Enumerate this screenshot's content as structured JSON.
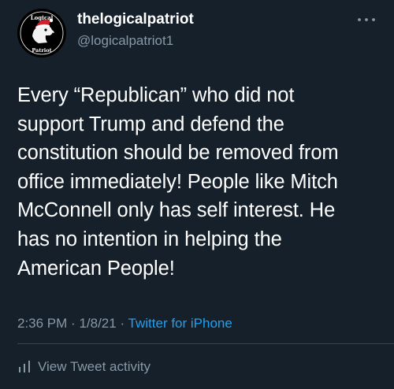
{
  "tweet": {
    "author": {
      "display_name": "thelogicalpatriot",
      "handle": "@logicalpatriot1",
      "avatar_text_top": "Logical",
      "avatar_text_bottom": "Patriot",
      "avatar_icon": "eagle-head-icon"
    },
    "text": "Every “Republican” who did not\nsupport Trump and defend the\nconstitution should be removed from\noffice immediately! People like Mitch\nMcConnell only has self interest. He\nhas no intention in helping the\nAmerican People!",
    "time": "2:36 PM",
    "separator": "·",
    "date": "1/8/21",
    "source": "Twitter for iPhone"
  },
  "activity": {
    "label": "View Tweet activity",
    "icon": "bar-chart-icon"
  },
  "menu": {
    "icon": "more-horizontal-icon"
  },
  "colors": {
    "background": "#15202b",
    "primary_text": "#ffffff",
    "secondary_text": "#8899a6",
    "accent": "#1da1f2",
    "divider": "#38444d"
  }
}
